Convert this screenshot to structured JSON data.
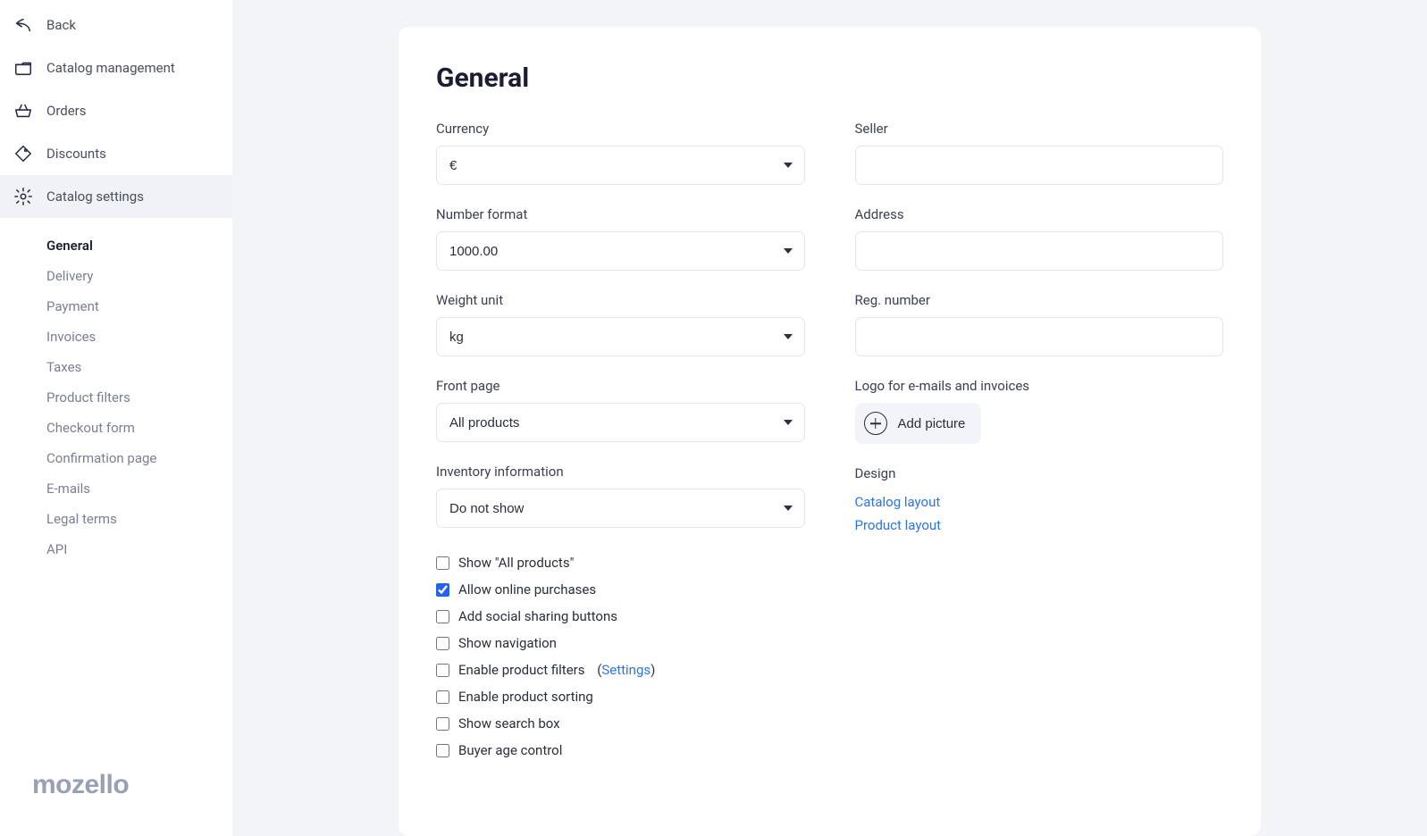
{
  "sidebar": {
    "items": [
      {
        "label": "Back"
      },
      {
        "label": "Catalog management"
      },
      {
        "label": "Orders"
      },
      {
        "label": "Discounts"
      },
      {
        "label": "Catalog settings"
      }
    ],
    "subitems": [
      {
        "label": "General"
      },
      {
        "label": "Delivery"
      },
      {
        "label": "Payment"
      },
      {
        "label": "Invoices"
      },
      {
        "label": "Taxes"
      },
      {
        "label": "Product filters"
      },
      {
        "label": "Checkout form"
      },
      {
        "label": "Confirmation page"
      },
      {
        "label": "E-mails"
      },
      {
        "label": "Legal terms"
      },
      {
        "label": "API"
      }
    ],
    "brand": "mozello"
  },
  "main": {
    "title": "General",
    "left": {
      "currency": {
        "label": "Currency",
        "value": "€"
      },
      "numberFormat": {
        "label": "Number format",
        "value": "1000.00"
      },
      "weightUnit": {
        "label": "Weight unit",
        "value": "kg"
      },
      "frontPage": {
        "label": "Front page",
        "value": "All products"
      },
      "inventory": {
        "label": "Inventory information",
        "value": "Do not show"
      },
      "checks": [
        {
          "label": "Show \"All products\"",
          "checked": false
        },
        {
          "label": "Allow online purchases",
          "checked": true
        },
        {
          "label": "Add social sharing buttons",
          "checked": false
        },
        {
          "label": "Show navigation",
          "checked": false
        },
        {
          "label": "Enable product filters",
          "checked": false,
          "settingsLink": "Settings"
        },
        {
          "label": "Enable product sorting",
          "checked": false
        },
        {
          "label": "Show search box",
          "checked": false
        },
        {
          "label": "Buyer age control",
          "checked": false
        }
      ]
    },
    "right": {
      "seller": {
        "label": "Seller",
        "value": ""
      },
      "address": {
        "label": "Address",
        "value": ""
      },
      "regNumber": {
        "label": "Reg. number",
        "value": ""
      },
      "logo": {
        "label": "Logo for e-mails and invoices",
        "button": "Add picture"
      },
      "design": {
        "label": "Design",
        "links": [
          "Catalog layout",
          "Product layout"
        ]
      }
    }
  }
}
